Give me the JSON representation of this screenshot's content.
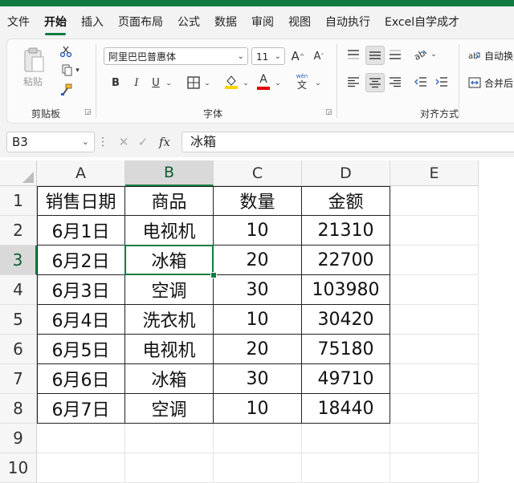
{
  "ribbon_tabs": [
    {
      "label": "文件"
    },
    {
      "label": "开始",
      "active": true
    },
    {
      "label": "插入"
    },
    {
      "label": "页面布局"
    },
    {
      "label": "公式"
    },
    {
      "label": "数据"
    },
    {
      "label": "审阅"
    },
    {
      "label": "视图"
    },
    {
      "label": "自动执行"
    },
    {
      "label": "Excel自学成才"
    }
  ],
  "clipboard": {
    "paste_label": "粘贴",
    "group_label": "剪贴板",
    "icons": [
      "paste-icon",
      "cut-icon",
      "copy-icon",
      "format-painter-icon"
    ]
  },
  "font": {
    "font_name": "阿里巴巴普惠体",
    "font_size": "11",
    "grow_label": "A^",
    "shrink_label": "A˅",
    "bold": "B",
    "italic": "I",
    "underline": "U",
    "font_color_letter": "A",
    "phonetic_top": "wén",
    "phonetic_bottom": "文",
    "group_label": "字体"
  },
  "alignment": {
    "wrap_label": "自动换",
    "merge_label": "合并后",
    "group_label": "对齐方式"
  },
  "colors": {
    "accent": "#107c41",
    "fill_highlight": "#ffd400",
    "font_red": "#e00000"
  },
  "formula_bar": {
    "name_box": "B3",
    "fx": "fx",
    "cancel_icon": "cancel-icon",
    "confirm_icon": "confirm-icon",
    "content": "冰箱"
  },
  "sheet": {
    "column_headers": [
      "A",
      "B",
      "C",
      "D",
      "E"
    ],
    "row_headers": [
      "1",
      "2",
      "3",
      "4",
      "5",
      "6",
      "7",
      "8",
      "9",
      "10"
    ],
    "selected_cell": "B3",
    "rows": [
      [
        "销售日期",
        "商品",
        "数量",
        "金额"
      ],
      [
        "6月1日",
        "电视机",
        "10",
        "21310"
      ],
      [
        "6月2日",
        "冰箱",
        "20",
        "22700"
      ],
      [
        "6月3日",
        "空调",
        "30",
        "103980"
      ],
      [
        "6月4日",
        "洗衣机",
        "10",
        "30420"
      ],
      [
        "6月5日",
        "电视机",
        "20",
        "75180"
      ],
      [
        "6月6日",
        "冰箱",
        "30",
        "49710"
      ],
      [
        "6月7日",
        "空调",
        "10",
        "18440"
      ]
    ]
  }
}
